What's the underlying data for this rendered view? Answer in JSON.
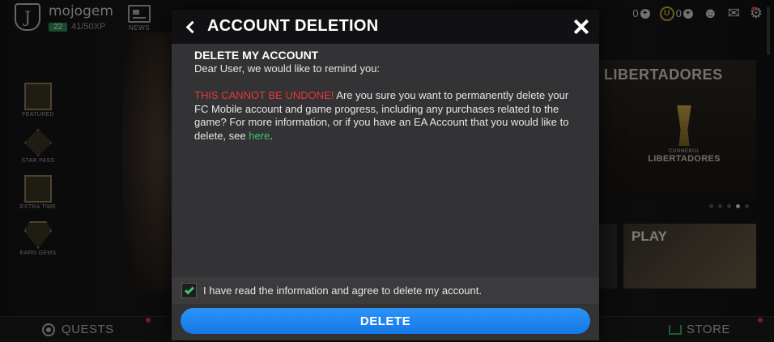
{
  "background": {
    "username": "mojogem",
    "level": "22",
    "xp": "41/50XP",
    "news_label": "NEWS",
    "side_menu": [
      {
        "label": "FEATURED",
        "icon": "gift-icon"
      },
      {
        "label": "STAR PASS",
        "icon": "star-pass-icon"
      },
      {
        "label": "EXTRA TIME",
        "icon": "extra-time-icon"
      },
      {
        "label": "EARN GEMS",
        "icon": "gem-icon"
      }
    ],
    "currency": [
      {
        "value": "0",
        "icon": "gem-currency-icon"
      },
      {
        "value": "0",
        "icon": "coin-icon",
        "symbol": "U"
      }
    ],
    "promo_title": "LIBERTADORES",
    "promo_logo_top": "CONMEBOL",
    "promo_logo": "LIBERTADORES",
    "play_label": "PLAY",
    "quests_label": "QUESTS",
    "store_label": "STORE"
  },
  "modal": {
    "title": "ACCOUNT DELETION",
    "section_heading": "DELETE MY ACCOUNT",
    "greeting": "Dear User, we would like to remind you:",
    "warning": "THIS CANNOT BE UNDONE!",
    "body": " Are you sure you want to permanently delete your FC Mobile account and game progress, including any purchases related to the game? For more information, or if you have an EA Account that you would like to delete, see ",
    "link_text": "here",
    "body_end": ".",
    "agree_label": "I have read the information and agree to delete my account.",
    "agree_checked": true,
    "delete_label": "DELETE"
  },
  "colors": {
    "warning": "#e5383b",
    "link": "#3fc36e",
    "delete_button": "#1e88f0",
    "modal_bg": "#333335",
    "header_bg": "#111113"
  }
}
